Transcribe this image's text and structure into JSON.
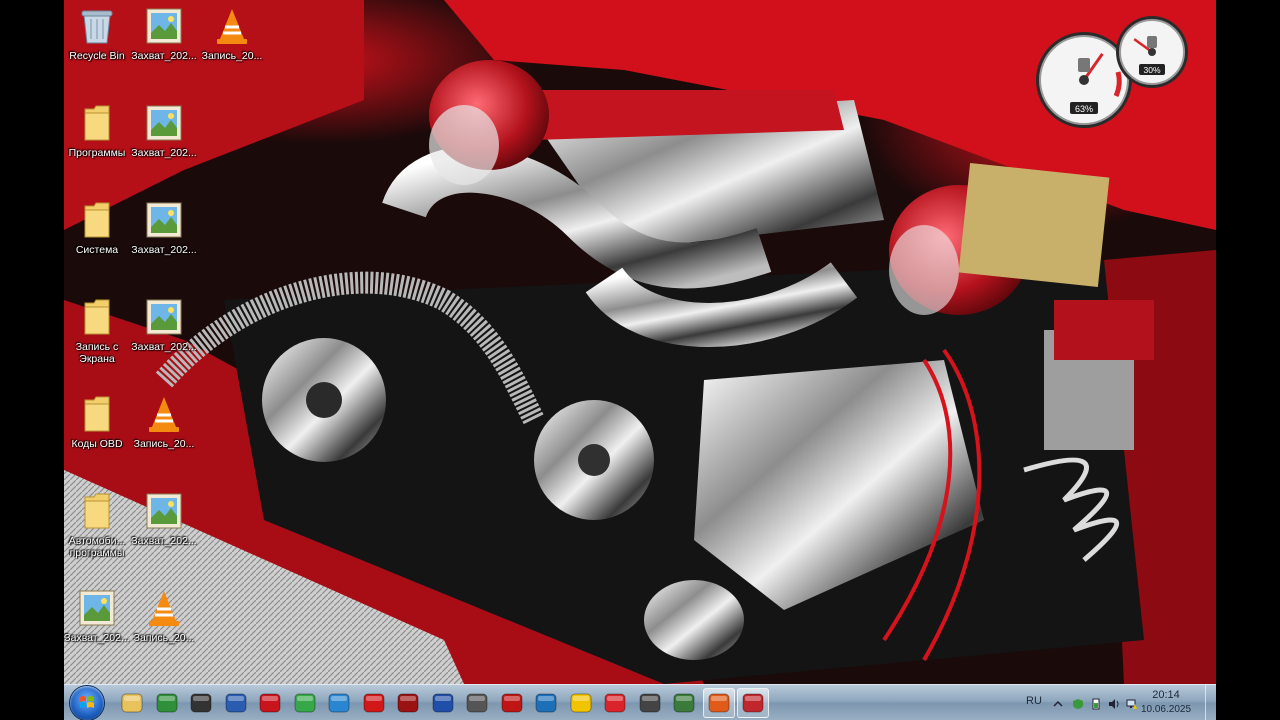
{
  "desktop": {
    "icons": [
      {
        "label": "Recycle Bin",
        "icon": "recycle-bin-icon"
      },
      {
        "label": "Захват_202...",
        "icon": "image-file-icon"
      },
      {
        "label": "Запись_20...",
        "icon": "vlc-cone-icon"
      },
      {
        "label": "Программы",
        "icon": "folder-icon"
      },
      {
        "label": "Захват_202...",
        "icon": "image-file-icon"
      },
      {
        "label": "Система",
        "icon": "folder-icon"
      },
      {
        "label": "Захват_202...",
        "icon": "image-file-icon"
      },
      {
        "label": "Запись с Экрана",
        "icon": "folder-icon"
      },
      {
        "label": "Захват_202...",
        "icon": "image-file-icon"
      },
      {
        "label": "Коды OBD",
        "icon": "folder-icon"
      },
      {
        "label": "Запись_20...",
        "icon": "vlc-cone-icon"
      },
      {
        "label": "Автомоби... программы",
        "icon": "folder-icon"
      },
      {
        "label": "Захват_202...",
        "icon": "image-file-icon"
      },
      {
        "label": "Захват_202...",
        "icon": "image-file-icon"
      },
      {
        "label": "Запись_20...",
        "icon": "vlc-cone-icon"
      }
    ]
  },
  "gadget": {
    "cpu_percent": "63%",
    "ram_percent": "30%",
    "cpu_value": 63,
    "ram_value": 30
  },
  "taskbar": {
    "pinned": [
      {
        "name": "explorer-icon",
        "color": "#e8c25a"
      },
      {
        "name": "monitor-app-icon",
        "color": "#2f8f3a"
      },
      {
        "name": "steering-wheel-icon",
        "color": "#333333"
      },
      {
        "name": "torque-app-icon",
        "color": "#2a5db0"
      },
      {
        "name": "obd-red-app-icon",
        "color": "#c8141c"
      },
      {
        "name": "elm-green-app-icon",
        "color": "#36a84a"
      },
      {
        "name": "globe-icon",
        "color": "#2a86d0"
      },
      {
        "name": "mitsubishi-icon",
        "color": "#d01818"
      },
      {
        "name": "mut-app-icon",
        "color": "#9b1212"
      },
      {
        "name": "ford-icon",
        "color": "#1f4fa8"
      },
      {
        "name": "mazda-icon",
        "color": "#555555"
      },
      {
        "name": "vag-icon",
        "color": "#c01515"
      },
      {
        "name": "car-diag-icon",
        "color": "#1d6fb8"
      },
      {
        "name": "check-engine-icon",
        "color": "#f2c400"
      },
      {
        "name": "red-car-icon",
        "color": "#d8242a"
      },
      {
        "name": "chip-icon",
        "color": "#444444"
      },
      {
        "name": "tools-icon",
        "color": "#3a7a3a"
      },
      {
        "name": "office-icon",
        "color": "#e05a1a"
      },
      {
        "name": "toolbox-icon",
        "color": "#c0272d"
      }
    ],
    "tray": {
      "language": "RU",
      "time": "20:14",
      "date": "10.06.2025"
    }
  }
}
